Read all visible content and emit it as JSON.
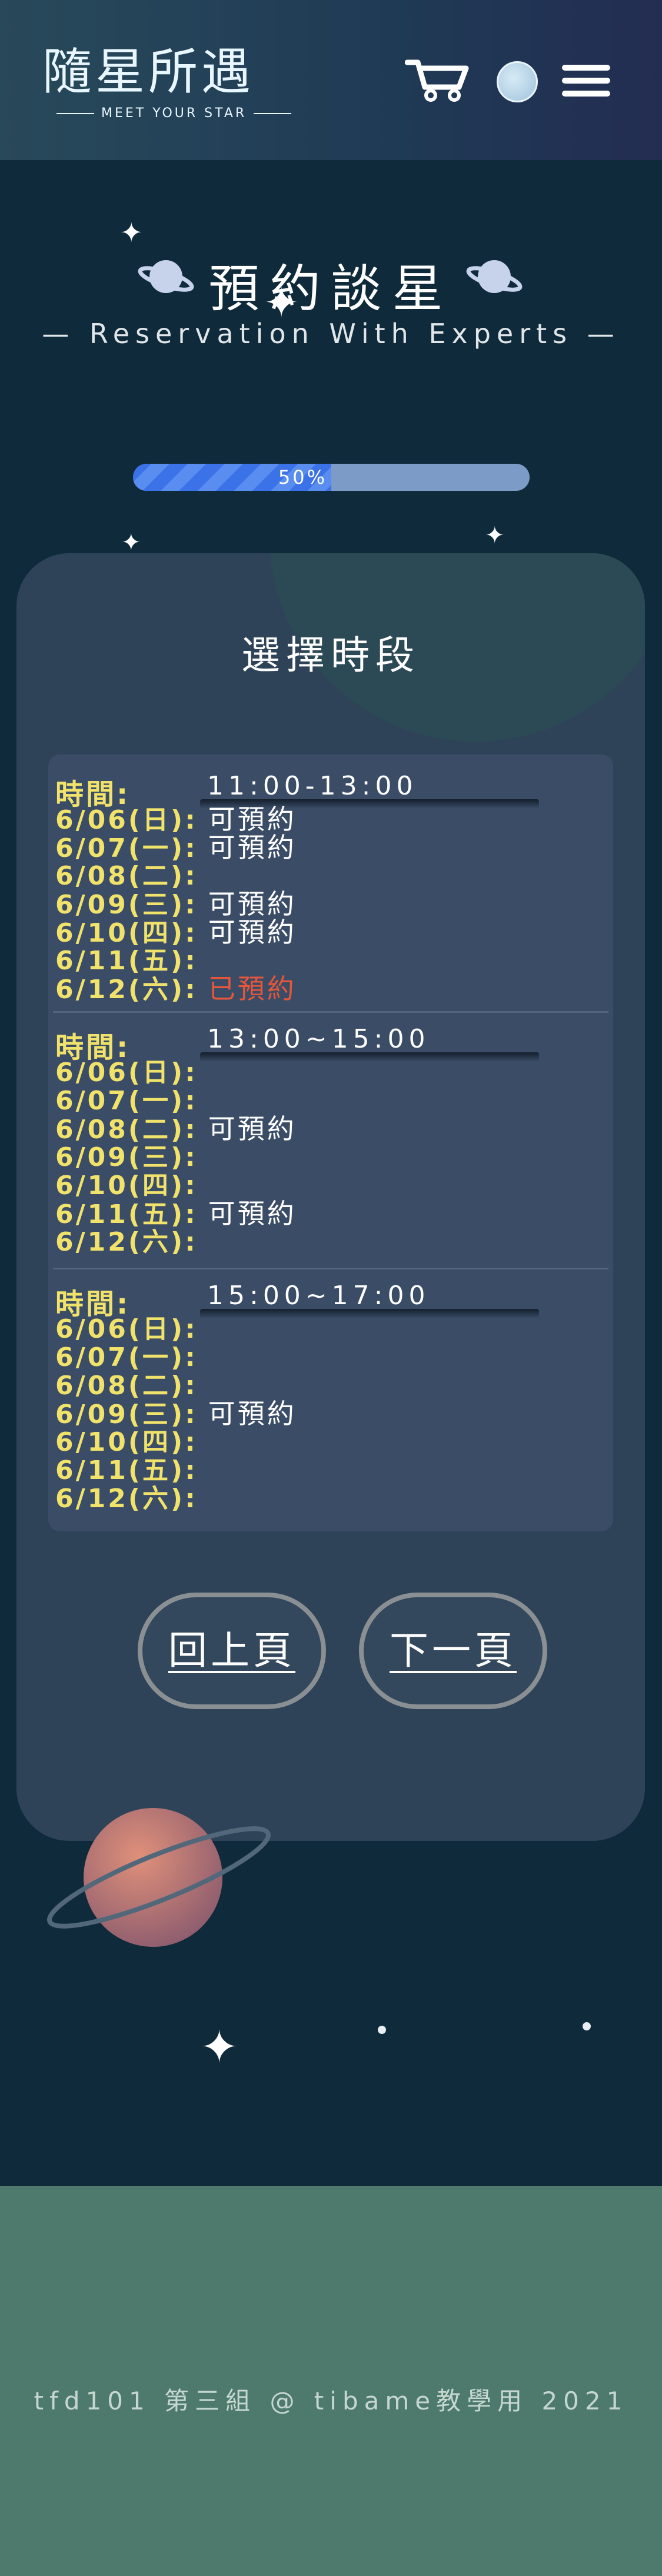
{
  "header": {
    "logo_title": "隨星所遇",
    "logo_subtitle": "MEET YOUR STAR",
    "cart_icon": "cart-icon",
    "avatar_icon": "avatar-icon",
    "menu_icon": "hamburger-menu-icon"
  },
  "page": {
    "title": "預約談星",
    "subtitle": "— Reservation With Experts —"
  },
  "progress": {
    "label": "50%",
    "value": 0.5
  },
  "card": {
    "section_title": "選擇時段",
    "blocks": [
      {
        "time_label": "時間:",
        "time_value": "11:00-13:00",
        "days": [
          {
            "day": "6/06(日):",
            "status": "可預約",
            "booked": false
          },
          {
            "day": "6/07(一):",
            "status": "可預約",
            "booked": false
          },
          {
            "day": "6/08(二):",
            "status": "",
            "booked": false
          },
          {
            "day": "6/09(三):",
            "status": "可預約",
            "booked": false
          },
          {
            "day": "6/10(四):",
            "status": "可預約",
            "booked": false
          },
          {
            "day": "6/11(五):",
            "status": "",
            "booked": false
          },
          {
            "day": "6/12(六):",
            "status": "已預約",
            "booked": true
          }
        ]
      },
      {
        "time_label": "時間:",
        "time_value": "13:00~15:00",
        "days": [
          {
            "day": "6/06(日):",
            "status": "",
            "booked": false
          },
          {
            "day": "6/07(一):",
            "status": "",
            "booked": false
          },
          {
            "day": "6/08(二):",
            "status": "可預約",
            "booked": false
          },
          {
            "day": "6/09(三):",
            "status": "",
            "booked": false
          },
          {
            "day": "6/10(四):",
            "status": "",
            "booked": false
          },
          {
            "day": "6/11(五):",
            "status": "可預約",
            "booked": false
          },
          {
            "day": "6/12(六):",
            "status": "",
            "booked": false
          }
        ]
      },
      {
        "time_label": "時間:",
        "time_value": "15:00~17:00",
        "days": [
          {
            "day": "6/06(日):",
            "status": "",
            "booked": false
          },
          {
            "day": "6/07(一):",
            "status": "",
            "booked": false
          },
          {
            "day": "6/08(二):",
            "status": "",
            "booked": false
          },
          {
            "day": "6/09(三):",
            "status": "可預約",
            "booked": false
          },
          {
            "day": "6/10(四):",
            "status": "",
            "booked": false
          },
          {
            "day": "6/11(五):",
            "status": "",
            "booked": false
          },
          {
            "day": "6/12(六):",
            "status": "",
            "booked": false
          }
        ]
      }
    ],
    "prev_button": "回上頁",
    "next_button": "下一頁"
  },
  "footer": {
    "text": "tfd101 第三組 @ tibame教學用 2021"
  },
  "colors": {
    "background": "#0f2a3a",
    "header": "#28495a",
    "day_label": "#f0e26a",
    "booked": "#e6563b",
    "progress_fill": "#3b72e8",
    "footer": "#4d7a6c"
  }
}
